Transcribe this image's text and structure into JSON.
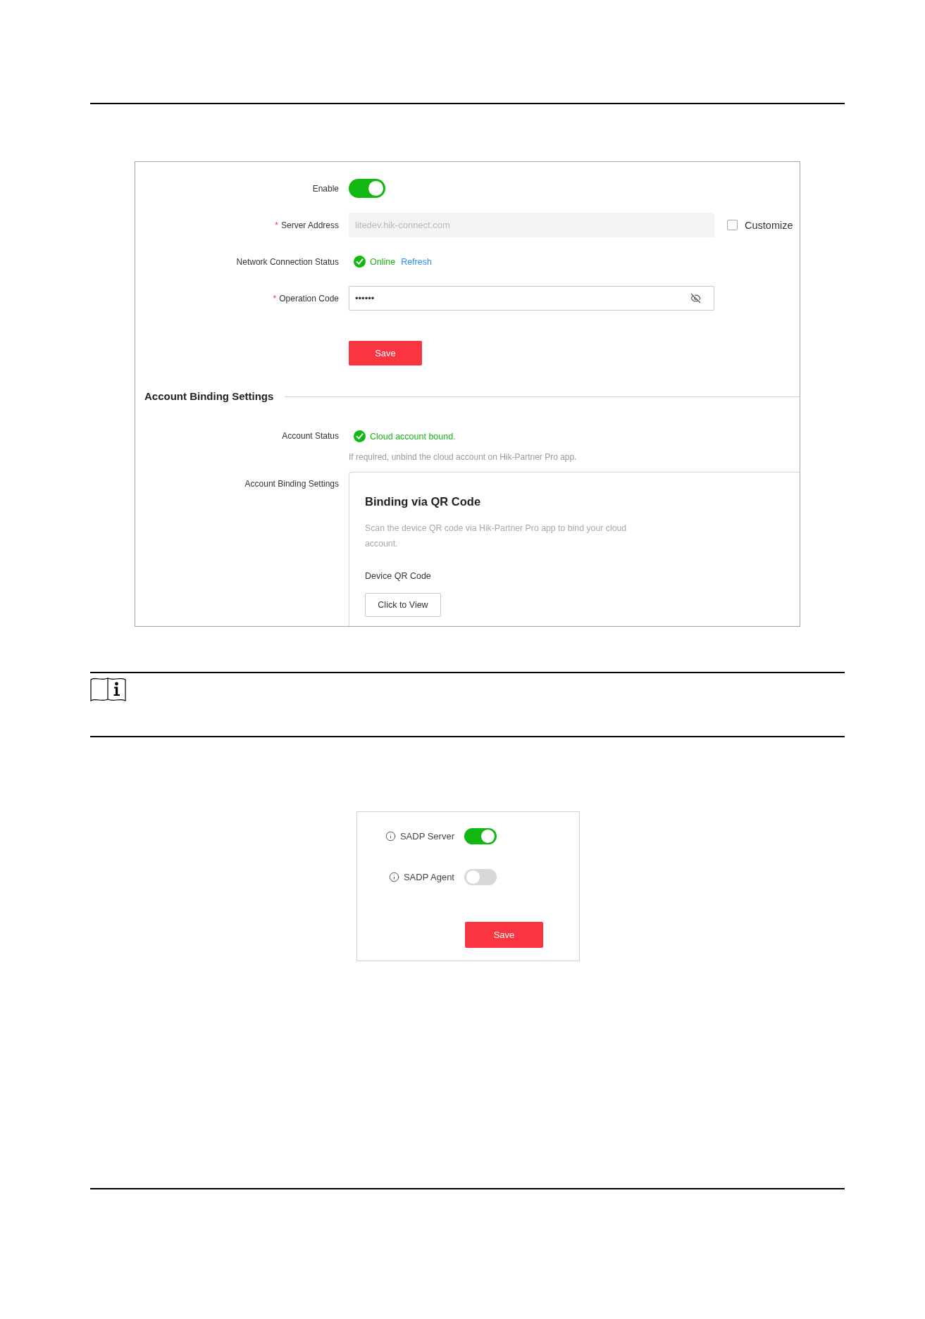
{
  "platform_panel": {
    "fields": [
      {
        "kind": "toggle",
        "label": "Enable",
        "on": true
      },
      {
        "kind": "text_input",
        "label": "Server Address",
        "required_mark": "*",
        "value": "litedev.hik-connect.com",
        "disabled": true,
        "checkbox": {
          "label": "Customize",
          "checked": false
        }
      },
      {
        "kind": "status",
        "label": "Network Connection Status",
        "status": "Online",
        "ok": true,
        "link": "Refresh"
      },
      {
        "kind": "password",
        "label": "Operation Code",
        "required_mark": "*",
        "value": "••••••"
      }
    ],
    "save_button": "Save",
    "section": {
      "title": "Account Binding Settings",
      "account_status": {
        "label": "Account Status",
        "status": "Cloud account bound.",
        "ok": true,
        "hint": "If required, unbind the cloud account on Hik-Partner Pro app."
      },
      "binding": {
        "label": "Account Binding Settings",
        "card": {
          "title": "Binding via QR Code",
          "description": "Scan the device QR code via Hik-Partner Pro app to bind your cloud account.",
          "qr_label": "Device QR Code",
          "button": "Click to View"
        }
      }
    }
  },
  "sadp_panel": {
    "switches": [
      {
        "label": "SADP Server",
        "on": true
      },
      {
        "label": "SADP Agent",
        "on": false
      }
    ],
    "save_button": "Save"
  }
}
